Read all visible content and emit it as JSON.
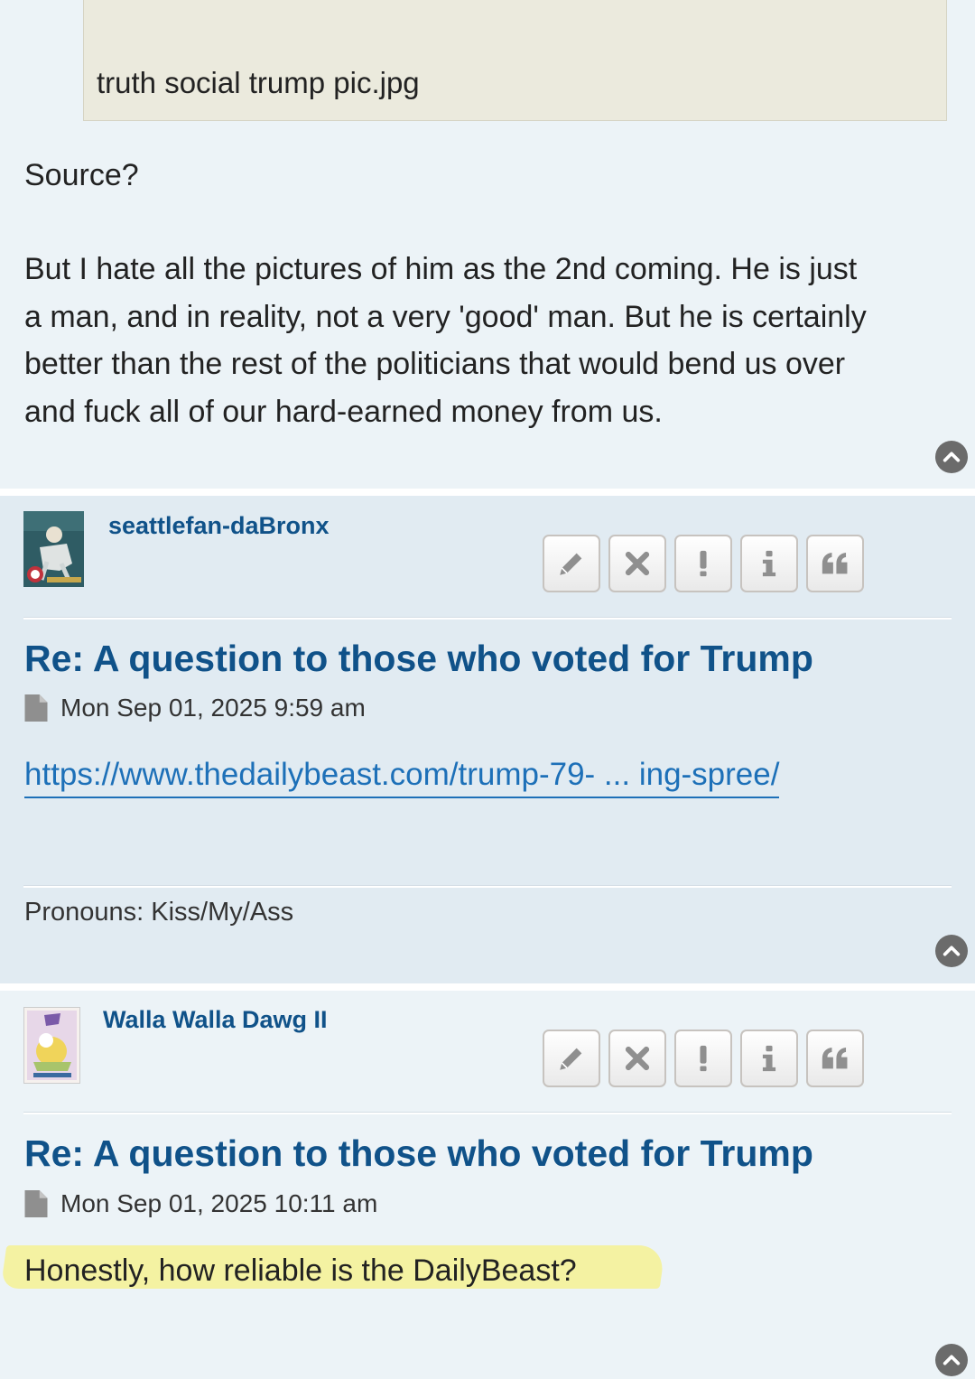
{
  "post1": {
    "attachment_name": "truth social trump pic.jpg",
    "text_line1": "Source?",
    "paragraph": [
      "But I hate all the pictures of him as the 2nd coming. He is just",
      "a man, and in reality, not a very 'good' man. But he is certainly",
      "better than the rest of the politicians that would bend us over",
      "and fuck all of our hard-earned money from us."
    ]
  },
  "post2": {
    "username": "seattlefan-daBronx",
    "title": "Re: A question to those who voted for Trump",
    "date": "Mon Sep 01, 2025 9:59 am",
    "link_text": "https://www.thedailybeast.com/trump-79- ... ing-spree/",
    "signature": "Pronouns: Kiss/My/Ass"
  },
  "post3": {
    "username": "Walla Walla Dawg II",
    "title": "Re: A question to those who voted for Trump",
    "date": "Mon Sep 01, 2025 10:11 am",
    "body": "Honestly, how reliable is the DailyBeast?"
  },
  "buttons": [
    "edit-icon",
    "delete-icon",
    "report-icon",
    "info-icon",
    "quote-icon"
  ],
  "colors": {
    "link_blue": "#105289",
    "url_blue": "#1d70b8",
    "post_bg_light": "#ecf3f7",
    "post_bg_dark": "#e1ebf2",
    "highlight": "#f4f2a2"
  }
}
